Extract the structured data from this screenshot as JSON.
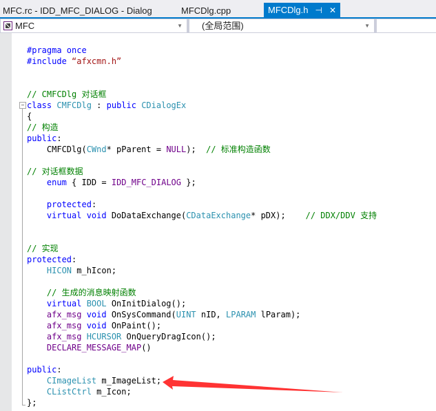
{
  "tabs": [
    {
      "label": "MFC.rc - IDD_MFC_DIALOG - Dialog",
      "active": false
    },
    {
      "label": "MFCDlg.cpp",
      "active": false
    },
    {
      "label": "MFCDlg.h",
      "active": true,
      "pin_icon": "⊣",
      "close_icon": "✕"
    }
  ],
  "navbar": {
    "project": "MFC",
    "scope": "(全局范围)",
    "member": ""
  },
  "code_lines": [
    [
      {
        "t": "#pragma once",
        "c": "kw"
      }
    ],
    [
      {
        "t": "#include ",
        "c": "kw"
      },
      {
        "t": "“afxcmn.h”",
        "c": "str"
      }
    ],
    [],
    [],
    [
      {
        "t": "// CMFCDlg 对话框",
        "c": "cm"
      }
    ],
    [
      {
        "t": "class ",
        "c": "kw"
      },
      {
        "t": "CMFCDlg",
        "c": "ty"
      },
      {
        "t": " : "
      },
      {
        "t": "public ",
        "c": "kw"
      },
      {
        "t": "CDialogEx",
        "c": "ty"
      }
    ],
    [
      {
        "t": "{"
      }
    ],
    [
      {
        "t": "// 构造",
        "c": "cm"
      }
    ],
    [
      {
        "t": "public",
        "c": "kw"
      },
      {
        "t": ":"
      }
    ],
    [
      {
        "t": "    CMFCDlg("
      },
      {
        "t": "CWnd",
        "c": "ty"
      },
      {
        "t": "* pParent = "
      },
      {
        "t": "NULL",
        "c": "mac"
      },
      {
        "t": ");  "
      },
      {
        "t": "// 标准构造函数",
        "c": "cm"
      }
    ],
    [],
    [
      {
        "t": "// 对话框数据",
        "c": "cm"
      }
    ],
    [
      {
        "t": "    "
      },
      {
        "t": "enum",
        "c": "kw"
      },
      {
        "t": " { IDD = "
      },
      {
        "t": "IDD_MFC_DIALOG",
        "c": "mac"
      },
      {
        "t": " };"
      }
    ],
    [],
    [
      {
        "t": "    "
      },
      {
        "t": "protected",
        "c": "kw"
      },
      {
        "t": ":"
      }
    ],
    [
      {
        "t": "    "
      },
      {
        "t": "virtual void ",
        "c": "kw"
      },
      {
        "t": "DoDataExchange("
      },
      {
        "t": "CDataExchange",
        "c": "ty"
      },
      {
        "t": "* pDX);    "
      },
      {
        "t": "// DDX/DDV 支持",
        "c": "cm"
      }
    ],
    [],
    [],
    [
      {
        "t": "// 实现",
        "c": "cm"
      }
    ],
    [
      {
        "t": "protected",
        "c": "kw"
      },
      {
        "t": ":"
      }
    ],
    [
      {
        "t": "    "
      },
      {
        "t": "HICON",
        "c": "ty"
      },
      {
        "t": " m_hIcon;"
      }
    ],
    [],
    [
      {
        "t": "    "
      },
      {
        "t": "// 生成的消息映射函数",
        "c": "cm"
      }
    ],
    [
      {
        "t": "    "
      },
      {
        "t": "virtual ",
        "c": "kw"
      },
      {
        "t": "BOOL",
        "c": "ty"
      },
      {
        "t": " OnInitDialog();"
      }
    ],
    [
      {
        "t": "    "
      },
      {
        "t": "afx_msg ",
        "c": "mac"
      },
      {
        "t": "void ",
        "c": "kw"
      },
      {
        "t": "OnSysCommand("
      },
      {
        "t": "UINT",
        "c": "ty"
      },
      {
        "t": " nID, "
      },
      {
        "t": "LPARAM",
        "c": "ty"
      },
      {
        "t": " lParam);"
      }
    ],
    [
      {
        "t": "    "
      },
      {
        "t": "afx_msg ",
        "c": "mac"
      },
      {
        "t": "void ",
        "c": "kw"
      },
      {
        "t": "OnPaint();"
      }
    ],
    [
      {
        "t": "    "
      },
      {
        "t": "afx_msg ",
        "c": "mac"
      },
      {
        "t": "HCURSOR",
        "c": "ty"
      },
      {
        "t": " OnQueryDragIcon();"
      }
    ],
    [
      {
        "t": "    "
      },
      {
        "t": "DECLARE_MESSAGE_MAP",
        "c": "mac"
      },
      {
        "t": "()"
      }
    ],
    [],
    [
      {
        "t": "public",
        "c": "kw"
      },
      {
        "t": ":"
      }
    ],
    [
      {
        "t": "    "
      },
      {
        "t": "CImageList",
        "c": "ty"
      },
      {
        "t": " m_ImageList;"
      }
    ],
    [
      {
        "t": "    "
      },
      {
        "t": "CListCtrl",
        "c": "ty"
      },
      {
        "t": " m_Icon;"
      }
    ],
    [
      {
        "t": "};"
      }
    ]
  ],
  "colors": {
    "accent": "#007acc",
    "keyword": "#0000ff",
    "type": "#2b91af",
    "macro": "#6f008a",
    "string": "#a31515",
    "comment": "#008000",
    "annotation_arrow": "#ff3333"
  }
}
